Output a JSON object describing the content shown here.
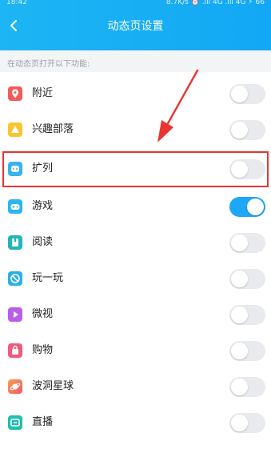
{
  "status_bar": {
    "time": "18:42",
    "right": "8.7K/s ⏰ .ıll 4G .ıll 4G ⚡ 66"
  },
  "header": {
    "title": "动态页设置",
    "back_icon": "chevron-left-icon"
  },
  "section": {
    "label": "在动态页打开以下功能:"
  },
  "colors": {
    "header": "#1db5f3",
    "toggle_on": "#1ea7f6",
    "highlight": "#e8352f"
  },
  "items": [
    {
      "label": "附近",
      "icon": "location-pin-icon",
      "color": "#f35a5a",
      "enabled": false
    },
    {
      "label": "兴趣部落",
      "icon": "warning-triangle-icon",
      "color": "#f8c530",
      "enabled": false
    },
    {
      "label": "扩列",
      "icon": "extend-list-icon",
      "color": "#38b3f0",
      "enabled": false
    },
    {
      "label": "游戏",
      "icon": "gamepad-icon",
      "color": "#2fb4f2",
      "enabled": true
    },
    {
      "label": "阅读",
      "icon": "book-icon",
      "color": "#1fb6b9",
      "enabled": false
    },
    {
      "label": "玩一玩",
      "icon": "play-circle-icon",
      "color": "#2ab0e8",
      "enabled": false
    },
    {
      "label": "微视",
      "icon": "video-play-icon",
      "color": "#b95ee8",
      "enabled": false
    },
    {
      "label": "购物",
      "icon": "shopping-bag-icon",
      "color": "#f05a7b",
      "enabled": false
    },
    {
      "label": "波洞星球",
      "icon": "planet-icon",
      "color": "#f2566a",
      "enabled": false
    },
    {
      "label": "直播",
      "icon": "live-broadcast-icon",
      "color": "#1fbfae",
      "enabled": false
    }
  ]
}
